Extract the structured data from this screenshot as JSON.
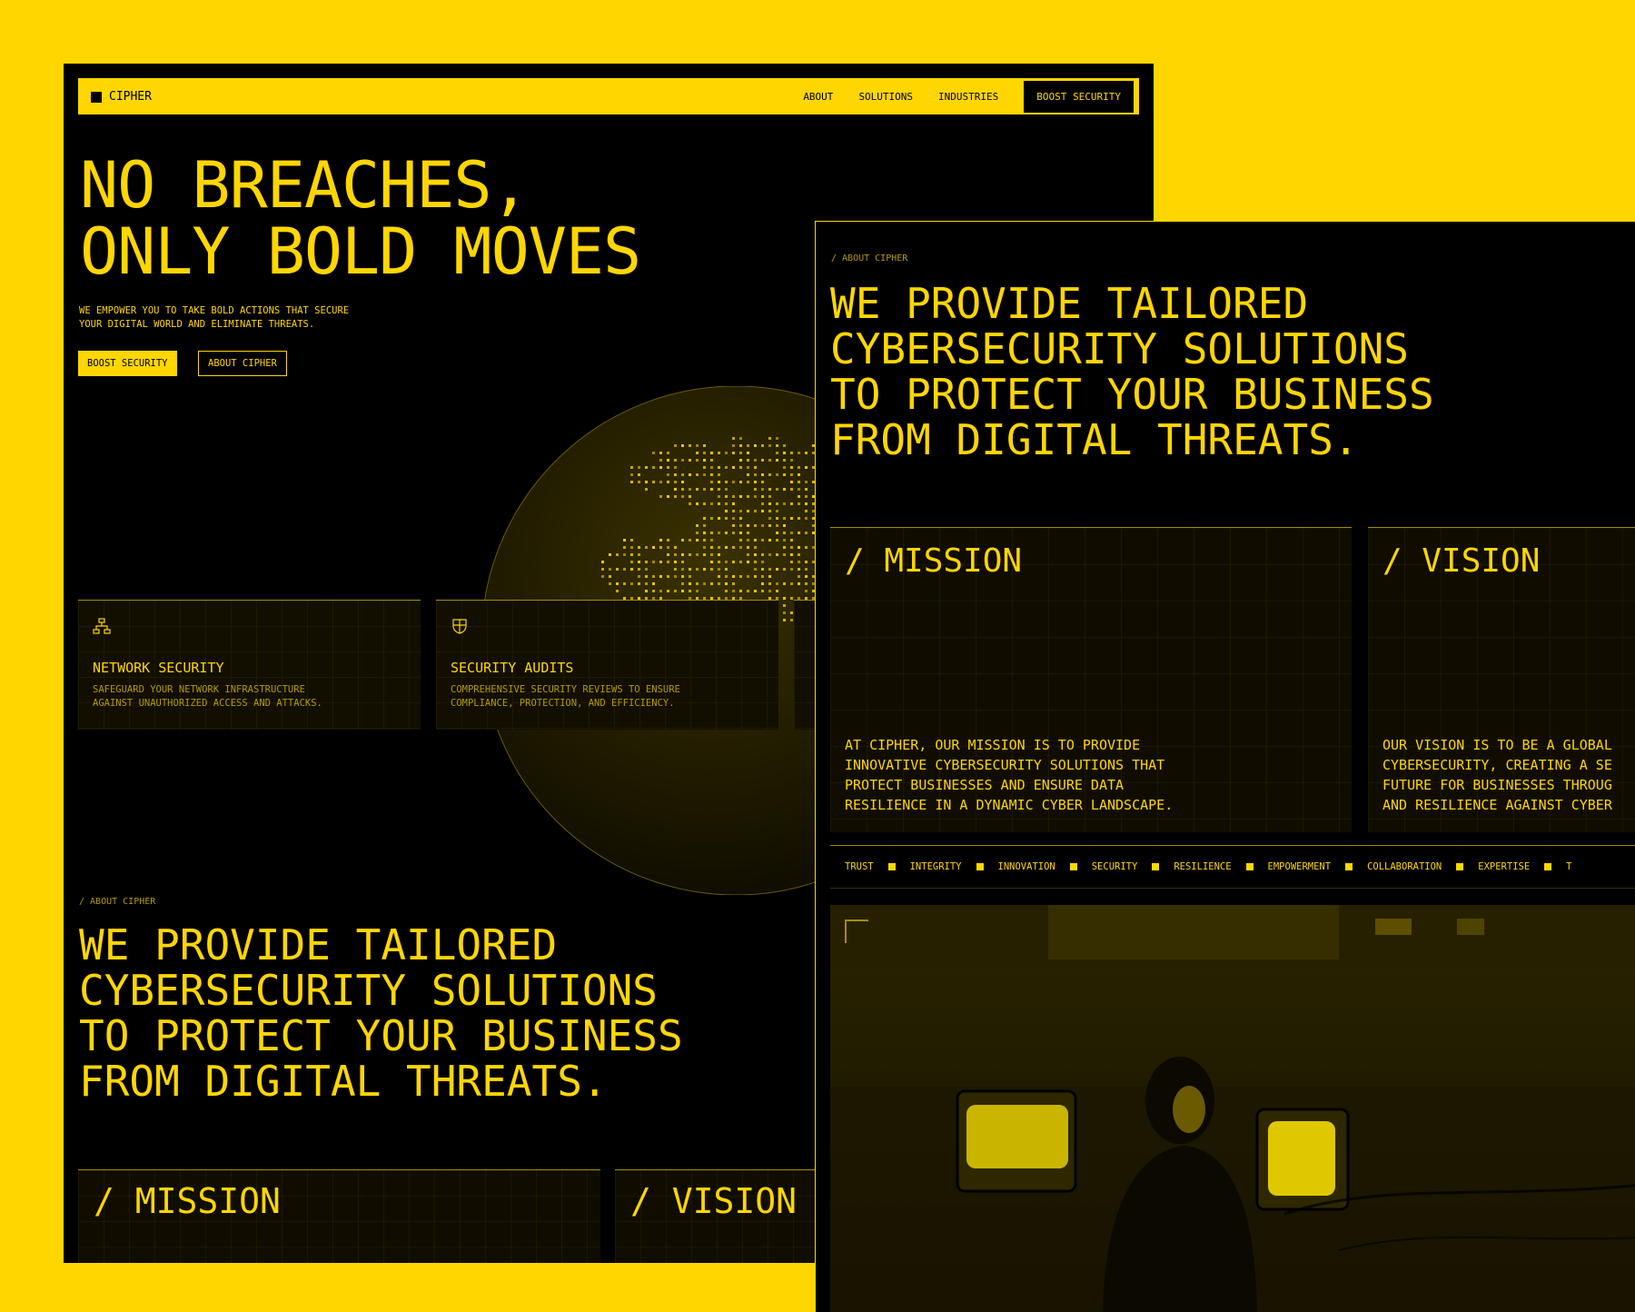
{
  "nav": {
    "brand": "CIPHER",
    "links": [
      "ABOUT",
      "SOLUTIONS",
      "INDUSTRIES"
    ],
    "cta": "BOOST SECURITY"
  },
  "hero": {
    "title_line1": "NO BREACHES,",
    "title_line2": "ONLY BOLD MOVES",
    "subtitle_line1": "WE EMPOWER YOU TO TAKE BOLD ACTIONS THAT SECURE",
    "subtitle_line2": "YOUR DIGITAL WORLD AND ELIMINATE THREATS.",
    "primary_button": "BOOST SECURITY",
    "secondary_button": "ABOUT CIPHER"
  },
  "services": [
    {
      "icon": "network-icon",
      "title": "NETWORK SECURITY",
      "desc_line1": "SAFEGUARD YOUR NETWORK INFRASTRUCTURE",
      "desc_line2": "AGAINST UNAUTHORIZED ACCESS AND ATTACKS."
    },
    {
      "icon": "shield-icon",
      "title": "SECURITY AUDITS",
      "desc_line1": "COMPREHENSIVE SECURITY REVIEWS TO ENSURE",
      "desc_line2": "COMPLIANCE, PROTECTION, AND EFFICIENCY."
    }
  ],
  "about": {
    "crumb": "/ ABOUT CIPHER",
    "title_lines": [
      "WE PROVIDE TAILORED",
      "CYBERSECURITY SOLUTIONS",
      "TO PROTECT YOUR BUSINESS",
      "FROM DIGITAL THREATS."
    ]
  },
  "mission": {
    "heading": "/ MISSION",
    "text": "AT CIPHER, OUR MISSION IS TO PROVIDE\nINNOVATIVE CYBERSECURITY SOLUTIONS THAT\nPROTECT BUSINESSES AND ENSURE DATA\nRESILIENCE IN A DYNAMIC CYBER LANDSCAPE."
  },
  "vision": {
    "heading": "/ VISION",
    "text": "OUR VISION IS TO BE A GLOBAL\nCYBERSECURITY, CREATING A SE\nFUTURE FOR BUSINESSES THROUG\nAND RESILIENCE AGAINST CYBER"
  },
  "values": [
    "TRUST",
    "INTEGRITY",
    "INNOVATION",
    "SECURITY",
    "RESILIENCE",
    "EMPOWERMENT",
    "COLLABORATION",
    "EXPERTISE",
    "T"
  ],
  "colors": {
    "accent": "#FFD600",
    "background": "#000000"
  }
}
